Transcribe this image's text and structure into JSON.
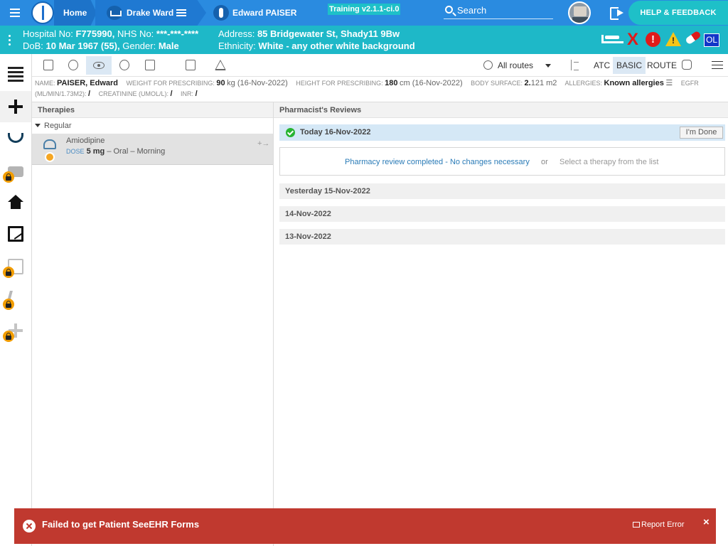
{
  "topbar": {
    "home_label": "Home",
    "ward_label": "Drake Ward",
    "patient_label": "Edward PAISER",
    "version_badge": "Training v2.1.1-ci.0",
    "search_placeholder": "Search",
    "help_label": "HELP & FEEDBACK"
  },
  "banner": {
    "hospital_label": "Hospital No:",
    "hospital_no": "F775990,",
    "nhs_label": "NHS No:",
    "nhs_no": "***-***-****",
    "dob_label": "DoB:",
    "dob": "10 Mar 1967 (55),",
    "gender_label": "Gender:",
    "gender": "Male",
    "address_label": "Address:",
    "address": "85 Bridgewater St, Shady11 9Bw",
    "ethnicity_label": "Ethnicity:",
    "ethnicity": "White - any other white background",
    "alerts": {
      "x_glyph": "X",
      "stop_glyph": "!",
      "ol_badge": "OL"
    },
    "alert_colors": {
      "red": "#e01a1a",
      "warning": "#f5c518",
      "badge": "#1236c8"
    }
  },
  "toolbar": {
    "routes_label": "All routes",
    "atc_label": "ATC",
    "basic_label": "BASIC",
    "route_label": "ROUTE"
  },
  "info": {
    "name_label": "NAME:",
    "name": "PAISER, Edward",
    "weight_label": "WEIGHT FOR PRESCRIBING:",
    "weight": "90",
    "weight_unit": "kg (16-Nov-2022)",
    "height_label": "HEIGHT FOR PRESCRIBING:",
    "height": "180",
    "height_unit": "cm (16-Nov-2022)",
    "surface_label": "BODY SURFACE:",
    "surface_int": "2.",
    "surface_dec": "121 m2",
    "allergies_label": "ALLERGIES:",
    "allergies": "Known allergies",
    "egfr_label": "EGFR",
    "egfr_unit_label": "(ML/MIN/1.73M2):",
    "egfr_value": "/",
    "creatinine_label": "CREATININE (UMOL/L):",
    "creatinine_value": "/",
    "inr_label": "INR:",
    "inr_value": "/"
  },
  "therapies": {
    "title": "Therapies",
    "group": "Regular",
    "items": [
      {
        "name": "Amiodipine",
        "dose_label": "DOSE",
        "dose": "5 mg",
        "dose_rest": " – Oral – Morning",
        "actions": "+→"
      }
    ]
  },
  "reviews": {
    "title": "Pharmacist's Reviews",
    "today_label": "Today 16-Nov-2022",
    "done_button": "I'm Done",
    "complete_link": "Pharmacy review completed - No changes necessary",
    "or_text": "or",
    "select_hint": "Select a therapy from the list",
    "history": [
      "Yesterday 15-Nov-2022",
      "14-Nov-2022",
      "13-Nov-2022"
    ]
  },
  "toast": {
    "message": "Failed to get Patient SeeEHR Forms",
    "report_label": "Report Error",
    "close_glyph": "×",
    "color": "#c0392f"
  }
}
